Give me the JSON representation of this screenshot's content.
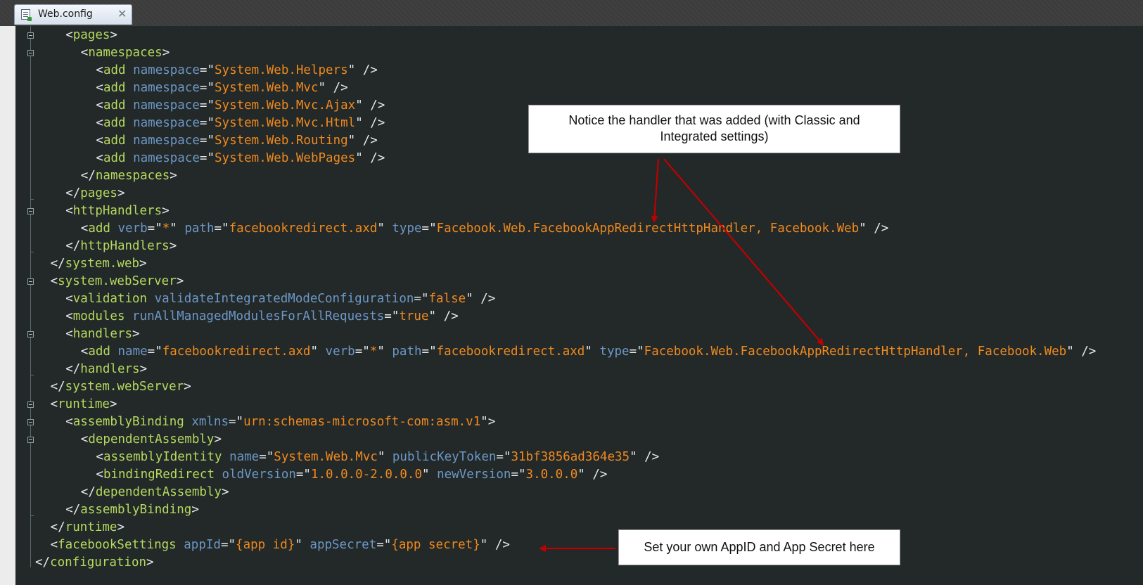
{
  "tab": {
    "label": "Web.config",
    "close_glyph": "✕",
    "icon": "config-file-icon"
  },
  "code_lines": [
    [
      {
        "t": "punc",
        "v": "<"
      },
      {
        "t": "name",
        "v": "pages"
      },
      {
        "t": "punc",
        "v": ">"
      }
    ],
    [
      {
        "t": "punc",
        "v": "<"
      },
      {
        "t": "name",
        "v": "namespaces"
      },
      {
        "t": "punc",
        "v": ">"
      }
    ],
    [
      {
        "t": "punc",
        "v": "<"
      },
      {
        "t": "name",
        "v": "add"
      },
      {
        "t": "punc",
        "v": " "
      },
      {
        "t": "attr",
        "v": "namespace"
      },
      {
        "t": "punc",
        "v": "=\""
      },
      {
        "t": "val",
        "v": "System.Web.Helpers"
      },
      {
        "t": "punc",
        "v": "\" />"
      }
    ],
    [
      {
        "t": "punc",
        "v": "<"
      },
      {
        "t": "name",
        "v": "add"
      },
      {
        "t": "punc",
        "v": " "
      },
      {
        "t": "attr",
        "v": "namespace"
      },
      {
        "t": "punc",
        "v": "=\""
      },
      {
        "t": "val",
        "v": "System.Web.Mvc"
      },
      {
        "t": "punc",
        "v": "\" />"
      }
    ],
    [
      {
        "t": "punc",
        "v": "<"
      },
      {
        "t": "name",
        "v": "add"
      },
      {
        "t": "punc",
        "v": " "
      },
      {
        "t": "attr",
        "v": "namespace"
      },
      {
        "t": "punc",
        "v": "=\""
      },
      {
        "t": "val",
        "v": "System.Web.Mvc.Ajax"
      },
      {
        "t": "punc",
        "v": "\" />"
      }
    ],
    [
      {
        "t": "punc",
        "v": "<"
      },
      {
        "t": "name",
        "v": "add"
      },
      {
        "t": "punc",
        "v": " "
      },
      {
        "t": "attr",
        "v": "namespace"
      },
      {
        "t": "punc",
        "v": "=\""
      },
      {
        "t": "val",
        "v": "System.Web.Mvc.Html"
      },
      {
        "t": "punc",
        "v": "\" />"
      }
    ],
    [
      {
        "t": "punc",
        "v": "<"
      },
      {
        "t": "name",
        "v": "add"
      },
      {
        "t": "punc",
        "v": " "
      },
      {
        "t": "attr",
        "v": "namespace"
      },
      {
        "t": "punc",
        "v": "=\""
      },
      {
        "t": "val",
        "v": "System.Web.Routing"
      },
      {
        "t": "punc",
        "v": "\" />"
      }
    ],
    [
      {
        "t": "punc",
        "v": "<"
      },
      {
        "t": "name",
        "v": "add"
      },
      {
        "t": "punc",
        "v": " "
      },
      {
        "t": "attr",
        "v": "namespace"
      },
      {
        "t": "punc",
        "v": "=\""
      },
      {
        "t": "val",
        "v": "System.Web.WebPages"
      },
      {
        "t": "punc",
        "v": "\" />"
      }
    ],
    [
      {
        "t": "punc",
        "v": "</"
      },
      {
        "t": "name",
        "v": "namespaces"
      },
      {
        "t": "punc",
        "v": ">"
      }
    ],
    [
      {
        "t": "punc",
        "v": "</"
      },
      {
        "t": "name",
        "v": "pages"
      },
      {
        "t": "punc",
        "v": ">"
      }
    ],
    [
      {
        "t": "punc",
        "v": "<"
      },
      {
        "t": "name",
        "v": "httpHandlers"
      },
      {
        "t": "punc",
        "v": ">"
      }
    ],
    [
      {
        "t": "punc",
        "v": "<"
      },
      {
        "t": "name",
        "v": "add"
      },
      {
        "t": "punc",
        "v": " "
      },
      {
        "t": "attr",
        "v": "verb"
      },
      {
        "t": "punc",
        "v": "=\""
      },
      {
        "t": "val",
        "v": "*"
      },
      {
        "t": "punc",
        "v": "\" "
      },
      {
        "t": "attr",
        "v": "path"
      },
      {
        "t": "punc",
        "v": "=\""
      },
      {
        "t": "val",
        "v": "facebookredirect.axd"
      },
      {
        "t": "punc",
        "v": "\" "
      },
      {
        "t": "attr",
        "v": "type"
      },
      {
        "t": "punc",
        "v": "=\""
      },
      {
        "t": "val",
        "v": "Facebook.Web.FacebookAppRedirectHttpHandler, Facebook.Web"
      },
      {
        "t": "punc",
        "v": "\" />"
      }
    ],
    [
      {
        "t": "punc",
        "v": "</"
      },
      {
        "t": "name",
        "v": "httpHandlers"
      },
      {
        "t": "punc",
        "v": ">"
      }
    ],
    [
      {
        "t": "punc",
        "v": "</"
      },
      {
        "t": "name",
        "v": "system.web"
      },
      {
        "t": "punc",
        "v": ">"
      }
    ],
    [
      {
        "t": "punc",
        "v": "<"
      },
      {
        "t": "name",
        "v": "system.webServer"
      },
      {
        "t": "punc",
        "v": ">"
      }
    ],
    [
      {
        "t": "punc",
        "v": "<"
      },
      {
        "t": "name",
        "v": "validation"
      },
      {
        "t": "punc",
        "v": " "
      },
      {
        "t": "attr",
        "v": "validateIntegratedModeConfiguration"
      },
      {
        "t": "punc",
        "v": "=\""
      },
      {
        "t": "val",
        "v": "false"
      },
      {
        "t": "punc",
        "v": "\" />"
      }
    ],
    [
      {
        "t": "punc",
        "v": "<"
      },
      {
        "t": "name",
        "v": "modules"
      },
      {
        "t": "punc",
        "v": " "
      },
      {
        "t": "attr",
        "v": "runAllManagedModulesForAllRequests"
      },
      {
        "t": "punc",
        "v": "=\""
      },
      {
        "t": "val",
        "v": "true"
      },
      {
        "t": "punc",
        "v": "\" />"
      }
    ],
    [
      {
        "t": "punc",
        "v": "<"
      },
      {
        "t": "name",
        "v": "handlers"
      },
      {
        "t": "punc",
        "v": ">"
      }
    ],
    [
      {
        "t": "punc",
        "v": "<"
      },
      {
        "t": "name",
        "v": "add"
      },
      {
        "t": "punc",
        "v": " "
      },
      {
        "t": "attr",
        "v": "name"
      },
      {
        "t": "punc",
        "v": "=\""
      },
      {
        "t": "val",
        "v": "facebookredirect.axd"
      },
      {
        "t": "punc",
        "v": "\" "
      },
      {
        "t": "attr",
        "v": "verb"
      },
      {
        "t": "punc",
        "v": "=\""
      },
      {
        "t": "val",
        "v": "*"
      },
      {
        "t": "punc",
        "v": "\" "
      },
      {
        "t": "attr",
        "v": "path"
      },
      {
        "t": "punc",
        "v": "=\""
      },
      {
        "t": "val",
        "v": "facebookredirect.axd"
      },
      {
        "t": "punc",
        "v": "\" "
      },
      {
        "t": "attr",
        "v": "type"
      },
      {
        "t": "punc",
        "v": "=\""
      },
      {
        "t": "val",
        "v": "Facebook.Web.FacebookAppRedirectHttpHandler, Facebook.Web"
      },
      {
        "t": "punc",
        "v": "\" />"
      }
    ],
    [
      {
        "t": "punc",
        "v": "</"
      },
      {
        "t": "name",
        "v": "handlers"
      },
      {
        "t": "punc",
        "v": ">"
      }
    ],
    [
      {
        "t": "punc",
        "v": "</"
      },
      {
        "t": "name",
        "v": "system.webServer"
      },
      {
        "t": "punc",
        "v": ">"
      }
    ],
    [
      {
        "t": "punc",
        "v": "<"
      },
      {
        "t": "name",
        "v": "runtime"
      },
      {
        "t": "punc",
        "v": ">"
      }
    ],
    [
      {
        "t": "punc",
        "v": "<"
      },
      {
        "t": "name",
        "v": "assemblyBinding"
      },
      {
        "t": "punc",
        "v": " "
      },
      {
        "t": "attr",
        "v": "xmlns"
      },
      {
        "t": "punc",
        "v": "=\""
      },
      {
        "t": "val",
        "v": "urn:schemas-microsoft-com:asm.v1"
      },
      {
        "t": "punc",
        "v": "\">"
      }
    ],
    [
      {
        "t": "punc",
        "v": "<"
      },
      {
        "t": "name",
        "v": "dependentAssembly"
      },
      {
        "t": "punc",
        "v": ">"
      }
    ],
    [
      {
        "t": "punc",
        "v": "<"
      },
      {
        "t": "name",
        "v": "assemblyIdentity"
      },
      {
        "t": "punc",
        "v": " "
      },
      {
        "t": "attr",
        "v": "name"
      },
      {
        "t": "punc",
        "v": "=\""
      },
      {
        "t": "val",
        "v": "System.Web.Mvc"
      },
      {
        "t": "punc",
        "v": "\" "
      },
      {
        "t": "attr",
        "v": "publicKeyToken"
      },
      {
        "t": "punc",
        "v": "=\""
      },
      {
        "t": "val",
        "v": "31bf3856ad364e35"
      },
      {
        "t": "punc",
        "v": "\" />"
      }
    ],
    [
      {
        "t": "punc",
        "v": "<"
      },
      {
        "t": "name",
        "v": "bindingRedirect"
      },
      {
        "t": "punc",
        "v": " "
      },
      {
        "t": "attr",
        "v": "oldVersion"
      },
      {
        "t": "punc",
        "v": "=\""
      },
      {
        "t": "val",
        "v": "1.0.0.0-2.0.0.0"
      },
      {
        "t": "punc",
        "v": "\" "
      },
      {
        "t": "attr",
        "v": "newVersion"
      },
      {
        "t": "punc",
        "v": "=\""
      },
      {
        "t": "val",
        "v": "3.0.0.0"
      },
      {
        "t": "punc",
        "v": "\" />"
      }
    ],
    [
      {
        "t": "punc",
        "v": "</"
      },
      {
        "t": "name",
        "v": "dependentAssembly"
      },
      {
        "t": "punc",
        "v": ">"
      }
    ],
    [
      {
        "t": "punc",
        "v": "</"
      },
      {
        "t": "name",
        "v": "assemblyBinding"
      },
      {
        "t": "punc",
        "v": ">"
      }
    ],
    [
      {
        "t": "punc",
        "v": "</"
      },
      {
        "t": "name",
        "v": "runtime"
      },
      {
        "t": "punc",
        "v": ">"
      }
    ],
    [
      {
        "t": "punc",
        "v": "<"
      },
      {
        "t": "name",
        "v": "facebookSettings"
      },
      {
        "t": "punc",
        "v": " "
      },
      {
        "t": "attr",
        "v": "appId"
      },
      {
        "t": "punc",
        "v": "=\""
      },
      {
        "t": "val",
        "v": "{app id}"
      },
      {
        "t": "punc",
        "v": "\" "
      },
      {
        "t": "attr",
        "v": "appSecret"
      },
      {
        "t": "punc",
        "v": "=\""
      },
      {
        "t": "val",
        "v": "{app secret}"
      },
      {
        "t": "punc",
        "v": "\" />"
      }
    ],
    [
      {
        "t": "punc",
        "v": "</"
      },
      {
        "t": "name",
        "v": "configuration"
      },
      {
        "t": "punc",
        "v": ">"
      }
    ]
  ],
  "callouts": {
    "handler_note_line1": "Notice the handler that was added (with Classic and",
    "handler_note_line2": "Integrated settings)",
    "appid_note": "Set your own AppID and App Secret here"
  },
  "colors": {
    "background": "#232829",
    "tag_name": "#b6d95e",
    "attribute": "#6c98c6",
    "value": "#ef8a1d",
    "punctuation": "#e4e8ea",
    "arrow": "#c00000"
  }
}
